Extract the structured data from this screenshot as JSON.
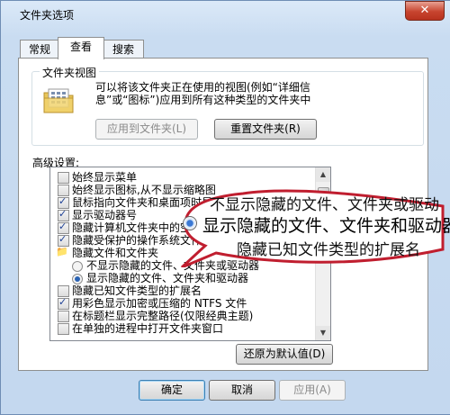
{
  "window": {
    "title": "文件夹选项",
    "close_label": "✕"
  },
  "tabs": [
    {
      "label": "常规"
    },
    {
      "label": "查看"
    },
    {
      "label": "搜索"
    }
  ],
  "folder_views": {
    "group_label": "文件夹视图",
    "description_line1": "可以将该文件夹正在使用的视图(例如“详细信",
    "description_line2": "息”或“图标”)应用到所有这种类型的文件夹中",
    "apply_button": "应用到文件夹(L)",
    "reset_button": "重置文件夹(R)"
  },
  "advanced": {
    "label": "高级设置:",
    "items": [
      {
        "type": "checkbox",
        "checked": false,
        "label": "始终显示菜单"
      },
      {
        "type": "checkbox",
        "checked": false,
        "label": "始终显示图标,从不显示缩略图"
      },
      {
        "type": "checkbox",
        "checked": true,
        "label": "鼠标指向文件夹和桌面项时显示"
      },
      {
        "type": "checkbox",
        "checked": true,
        "label": "显示驱动器号"
      },
      {
        "type": "checkbox",
        "checked": true,
        "label": "隐藏计算机文件夹中的空驱动器"
      },
      {
        "type": "checkbox",
        "checked": true,
        "label": "隐藏受保护的操作系统文件(推荐)"
      },
      {
        "type": "folder",
        "label": "隐藏文件和文件夹"
      },
      {
        "type": "radio",
        "checked": false,
        "label": "不显示隐藏的文件、文件夹或驱动器"
      },
      {
        "type": "radio",
        "checked": true,
        "label": "显示隐藏的文件、文件夹和驱动器"
      },
      {
        "type": "checkbox",
        "checked": false,
        "label": "隐藏已知文件类型的扩展名"
      },
      {
        "type": "checkbox",
        "checked": true,
        "label": "用彩色显示加密或压缩的 NTFS 文件"
      },
      {
        "type": "checkbox",
        "checked": false,
        "label": "在标题栏显示完整路径(仅限经典主题)"
      },
      {
        "type": "checkbox",
        "checked": false,
        "label": "在单独的进程中打开文件夹窗口"
      }
    ],
    "restore_button": "还原为默认值(D)"
  },
  "callout": {
    "line1": "不显示隐藏的文件、文件夹或驱动",
    "line2": "显示隐藏的文件、文件夹和驱动器",
    "line3": "隐藏已知文件类型的扩展名"
  },
  "footer": {
    "ok": "确定",
    "cancel": "取消",
    "apply": "应用(A)"
  }
}
